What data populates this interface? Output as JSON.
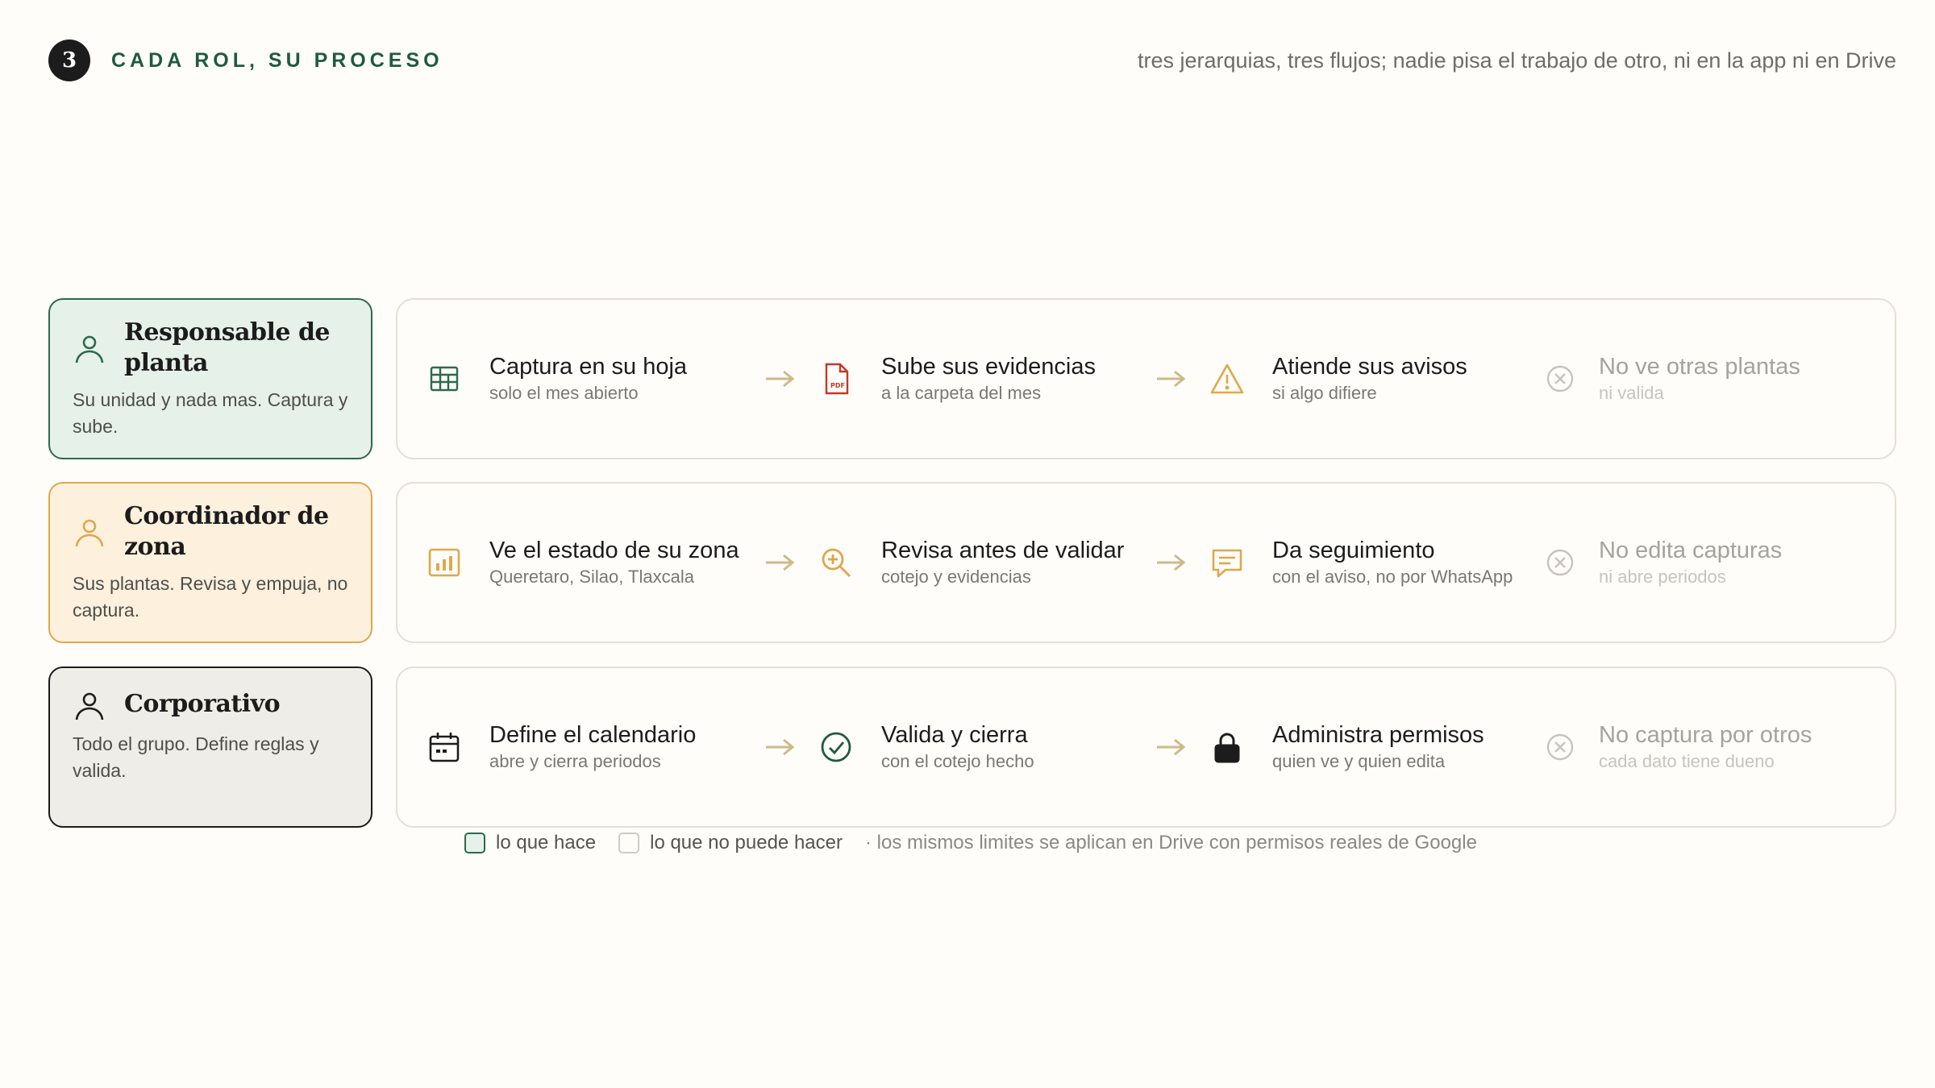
{
  "header": {
    "number": "3",
    "title": "CADA ROL, SU PROCESO",
    "tagline": "tres jerarquias, tres flujos; nadie pisa el trabajo de otro, ni en la app ni en Drive"
  },
  "roles": [
    {
      "name": "Responsable de planta",
      "description": "Su unidad y nada mas. Captura y sube.",
      "icon": "person-icon",
      "color": "#2c6a4c",
      "steps": [
        {
          "icon": "spreadsheet-icon",
          "title": "Captura en su hoja",
          "subtitle": "solo el mes abierto"
        },
        {
          "icon": "pdf-icon",
          "title": "Sube sus evidencias",
          "subtitle": "a la carpeta del mes"
        },
        {
          "icon": "warning-icon",
          "title": "Atiende sus avisos",
          "subtitle": "si algo difiere"
        }
      ],
      "restriction": {
        "icon": "x-circle-icon",
        "title": "No ve otras plantas",
        "subtitle": "ni valida"
      }
    },
    {
      "name": "Coordinador de zona",
      "description": "Sus plantas. Revisa y empuja, no captura.",
      "icon": "person-icon",
      "color": "#e0a74a",
      "steps": [
        {
          "icon": "bar-chart-icon",
          "title": "Ve el estado de su zona",
          "subtitle": "Queretaro, Silao, Tlaxcala"
        },
        {
          "icon": "magnifier-icon",
          "title": "Revisa antes de validar",
          "subtitle": "cotejo y evidencias"
        },
        {
          "icon": "chat-icon",
          "title": "Da seguimiento",
          "subtitle": "con el aviso, no por WhatsApp"
        }
      ],
      "restriction": {
        "icon": "x-circle-icon",
        "title": "No edita capturas",
        "subtitle": "ni abre periodos"
      }
    },
    {
      "name": "Corporativo",
      "description": "Todo el grupo. Define reglas y valida.",
      "icon": "person-icon",
      "color": "#1c1c1c",
      "steps": [
        {
          "icon": "calendar-icon",
          "title": "Define el calendario",
          "subtitle": "abre y cierra periodos"
        },
        {
          "icon": "check-circle-icon",
          "title": "Valida y cierra",
          "subtitle": "con el cotejo hecho"
        },
        {
          "icon": "lock-icon",
          "title": "Administra permisos",
          "subtitle": "quien ve y quien edita"
        }
      ],
      "restriction": {
        "icon": "x-circle-icon",
        "title": "No captura por otros",
        "subtitle": "cada dato tiene dueno"
      }
    }
  ],
  "legend": {
    "does": "lo que hace",
    "cannot": "lo que no puede hacer",
    "note": "· los mismos limites se aplican en Drive con permisos reales de Google"
  },
  "colors": {
    "green": "#2c6a4c",
    "amber": "#e0a74a",
    "dark": "#1c1c1c",
    "pdf_red": "#c0392b",
    "arrow": "#cfb98a",
    "muted": "#c6c4bd"
  }
}
